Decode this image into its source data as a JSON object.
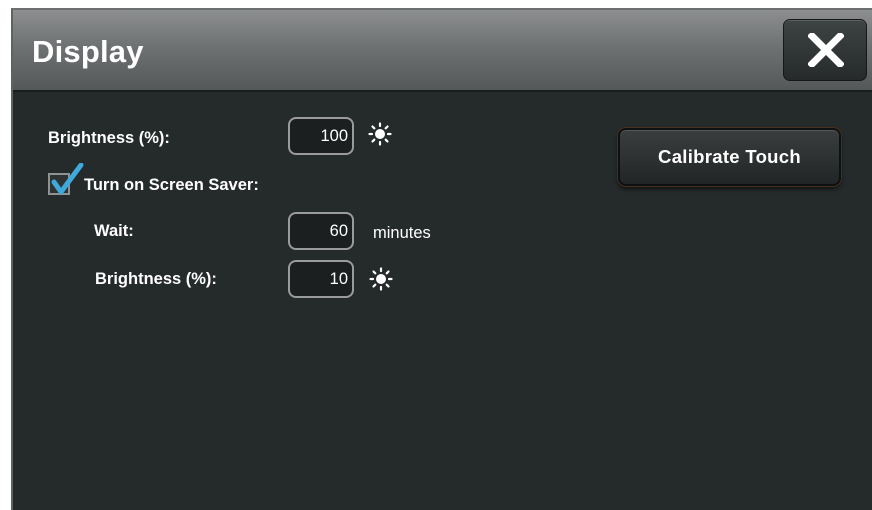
{
  "dialog": {
    "title": "Display",
    "close_label": "close"
  },
  "brightness": {
    "label": "Brightness (%):",
    "value": "100"
  },
  "screen_saver": {
    "checkbox_label": "Turn on Screen Saver:",
    "checked": true,
    "wait_label": "Wait:",
    "wait_value": "60",
    "wait_unit": "minutes",
    "brightness_label": "Brightness (%):",
    "brightness_value": "10"
  },
  "calibrate_button": {
    "label": "Calibrate Touch"
  },
  "icons": {
    "brightness": "sun-icon",
    "close": "close-icon",
    "check": "checkmark-icon"
  },
  "colors": {
    "background": "#252a2b",
    "titlebar": "#6f7273",
    "text": "#ffffff",
    "checkmark": "#3fa9dc"
  }
}
